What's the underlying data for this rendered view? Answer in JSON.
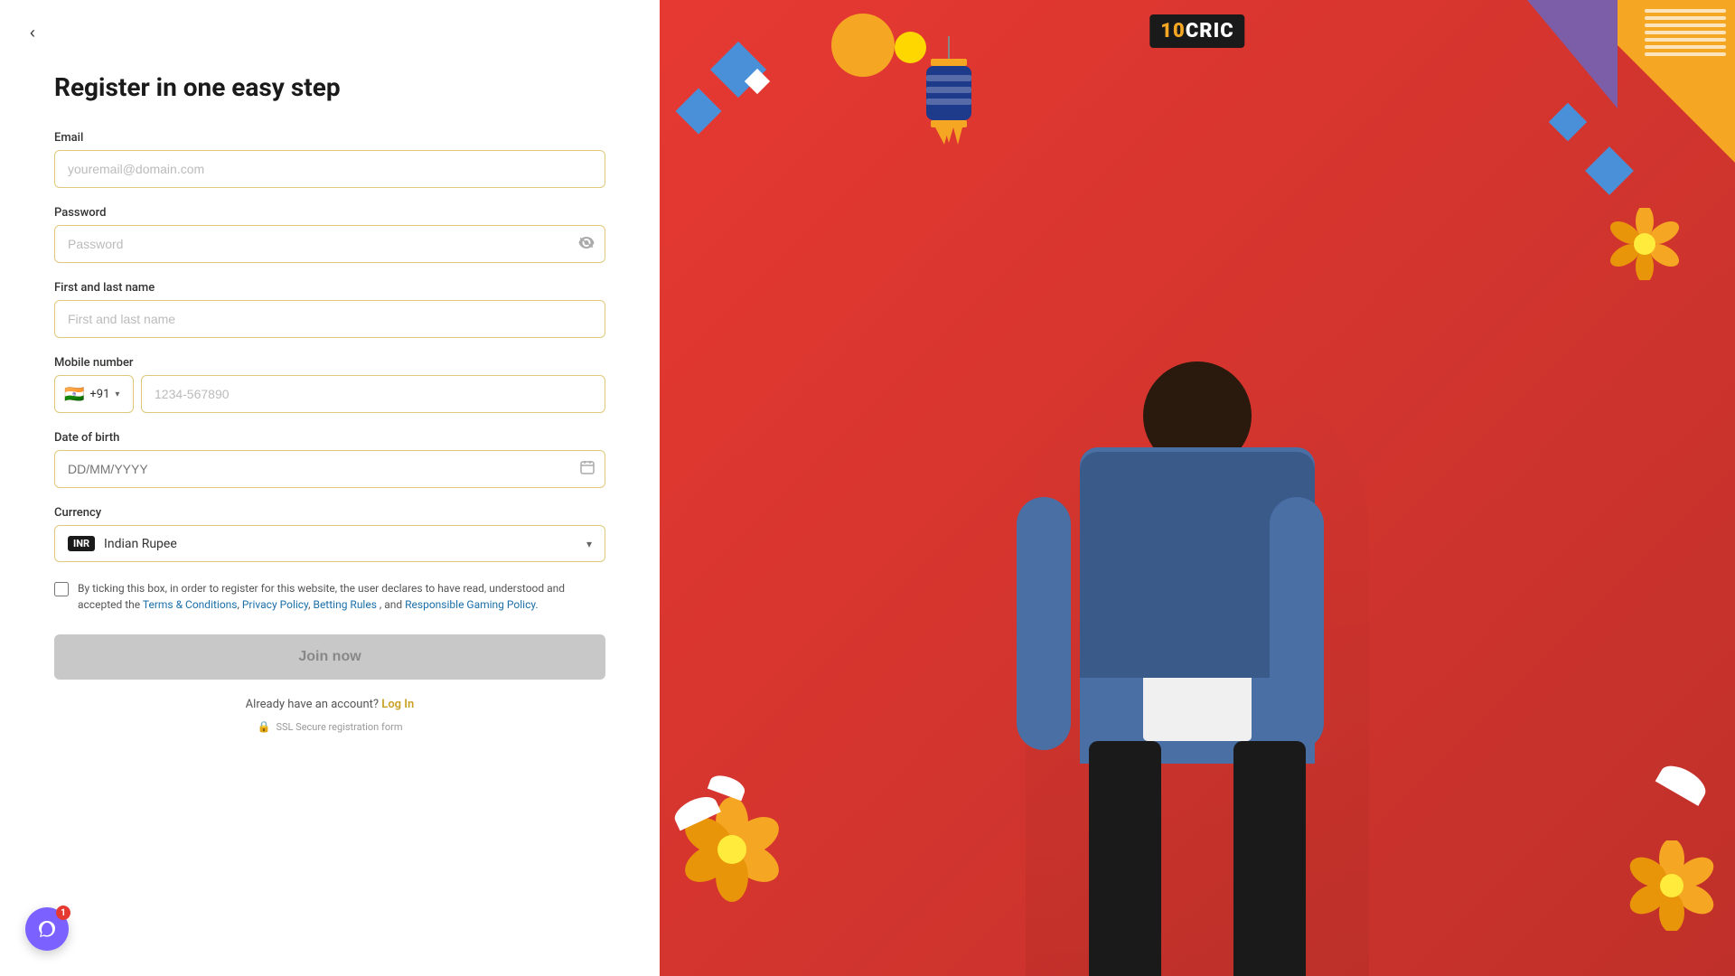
{
  "meta": {
    "title": "10CRIC - Register"
  },
  "header": {
    "logo_text": "10CRIC",
    "logo_ten": "10",
    "logo_cric": "CRIC"
  },
  "back_button": {
    "label": "‹",
    "aria": "Go back"
  },
  "form": {
    "title": "Register in one easy step",
    "email": {
      "label": "Email",
      "placeholder": "youremail@domain.com",
      "value": ""
    },
    "password": {
      "label": "Password",
      "placeholder": "Password",
      "value": ""
    },
    "full_name": {
      "label": "First and last name",
      "placeholder": "First and last name",
      "value": ""
    },
    "mobile": {
      "label": "Mobile number",
      "country_code": "+91",
      "country_flag": "🇮🇳",
      "placeholder": "1234-567890",
      "value": ""
    },
    "dob": {
      "label": "Date of birth",
      "placeholder": "DD/MM/YYYY",
      "value": ""
    },
    "currency": {
      "label": "Currency",
      "badge": "INR",
      "name": "Indian Rupee"
    },
    "terms": {
      "text_before": "By ticking this box, in order to register for this website, the user declares to have read, understood and accepted the",
      "terms_link_text": "Terms & Conditions",
      "comma1": ",",
      "privacy_link_text": "Privacy Policy",
      "comma2": ",",
      "betting_link_text": "Betting Rules",
      "and_text": ", and",
      "gaming_link_text": "Responsible Gaming Policy."
    },
    "join_button": "Join now",
    "already_account_text": "Already have an account?",
    "login_link_text": "Log In",
    "secure_text": "SSL Secure registration form"
  },
  "chat": {
    "badge_count": "1"
  }
}
